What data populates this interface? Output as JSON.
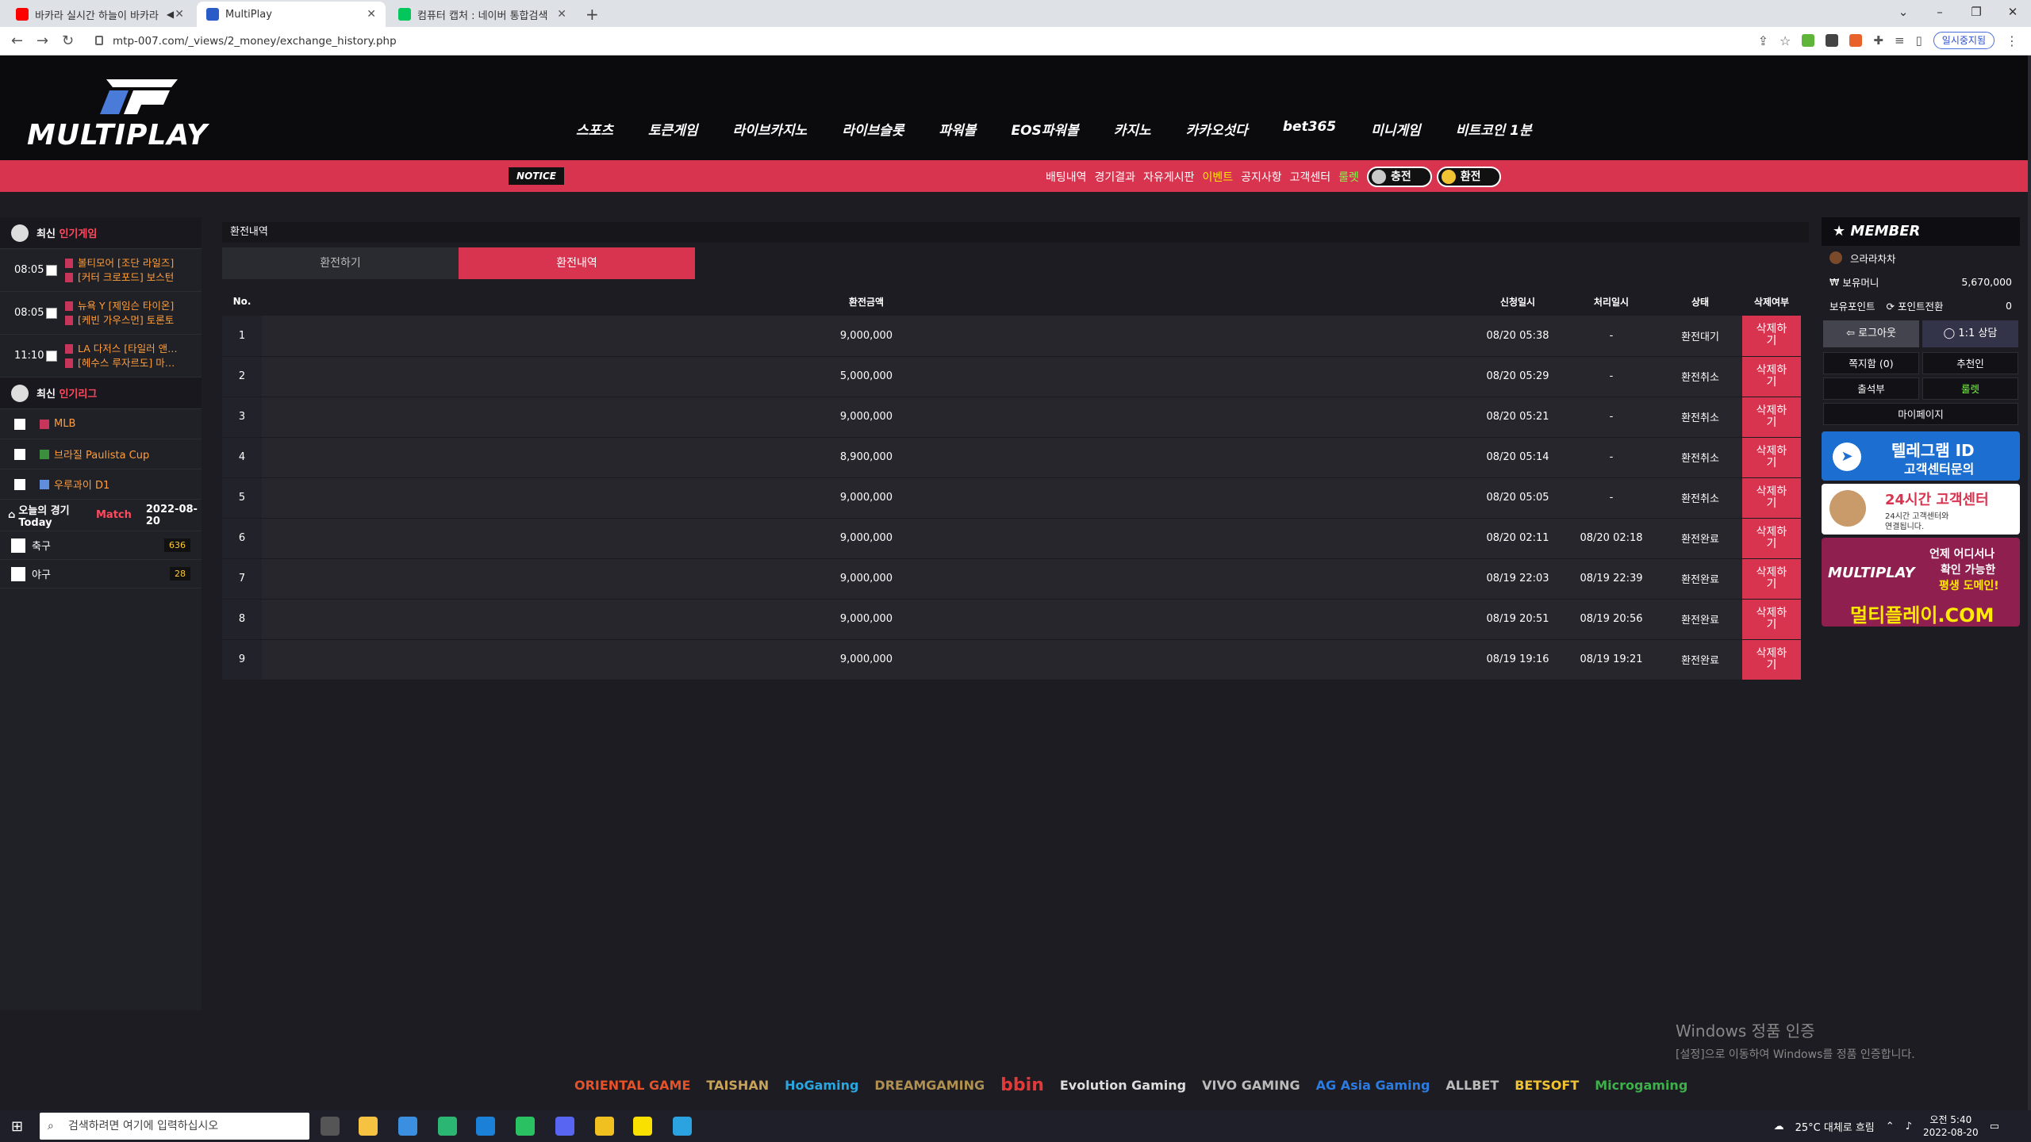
{
  "browser": {
    "tabs": [
      {
        "title": "바카라 실시간 하늘이 바카라",
        "icon": "youtube-icon",
        "color": "#ff0000",
        "active": false
      },
      {
        "title": "MultiPlay",
        "icon": "multiplay-icon",
        "color": "#2a5cc8",
        "active": true
      },
      {
        "title": "컴퓨터 캡처 : 네이버 통합검색",
        "icon": "naver-icon",
        "color": "#03c75a",
        "active": false
      }
    ],
    "url": "mtp-007.com/_views/2_money/exchange_history.php",
    "profile_label": "일시중지됨"
  },
  "site": {
    "logo_text": "MULTIPLAY",
    "nav": [
      "스포츠",
      "토큰게임",
      "라이브카지노",
      "라이브슬롯",
      "파워볼",
      "EOS파워볼",
      "카지노",
      "카카오섯다",
      "bet365",
      "미니게임",
      "비트코인 1분"
    ],
    "notice_badge": "NOTICE",
    "sublinks": [
      {
        "label": "배팅내역",
        "style": "normal"
      },
      {
        "label": "경기결과",
        "style": "normal"
      },
      {
        "label": "자유게시판",
        "style": "normal"
      },
      {
        "label": "이벤트",
        "style": "yellow"
      },
      {
        "label": "공지사항",
        "style": "normal"
      },
      {
        "label": "고객센터",
        "style": "normal"
      },
      {
        "label": "룰렛",
        "style": "green"
      }
    ],
    "charge_label": "충전",
    "exchange_label": "환전"
  },
  "left": {
    "recent_games_head": {
      "prefix": "최신",
      "highlight": "인기게임"
    },
    "games": [
      {
        "time": "08:05",
        "home": "볼티모어 [조단 라일즈]",
        "away": "[커터 크로포드] 보스턴"
      },
      {
        "time": "08:05",
        "home": "뉴욕 Y [제임슨 타이온]",
        "away": "[케빈 가우스먼] 토론토"
      },
      {
        "time": "11:10",
        "home": "LA 다저스 [타일러 앤…",
        "away": "[헤수스 루자르도] 마…"
      }
    ],
    "recent_league_head": {
      "prefix": "최신",
      "highlight": "인기리그"
    },
    "leagues": [
      "MLB",
      "브라질 Paulista Cup",
      "우루과이 D1"
    ],
    "today": {
      "prefix": "오늘의 경기 Today",
      "highlight": "Match",
      "date": "2022-08-20"
    },
    "sports": [
      {
        "name": "축구",
        "count": "636"
      },
      {
        "name": "야구",
        "count": "28"
      }
    ]
  },
  "main": {
    "page_title": "환전내역",
    "tab_exchange": "환전하기",
    "tab_history": "환전내역",
    "columns": {
      "no": "No.",
      "amount": "환전금액",
      "requested": "신청일시",
      "processed": "처리일시",
      "status": "상태",
      "delete": "삭제여부"
    },
    "rows": [
      {
        "no": "1",
        "amount": "9,000,000",
        "requested": "08/20 05:38",
        "processed": "-",
        "status": "환전대기",
        "delete": "삭제하기"
      },
      {
        "no": "2",
        "amount": "5,000,000",
        "requested": "08/20 05:29",
        "processed": "-",
        "status": "환전취소",
        "delete": "삭제하기"
      },
      {
        "no": "3",
        "amount": "9,000,000",
        "requested": "08/20 05:21",
        "processed": "-",
        "status": "환전취소",
        "delete": "삭제하기"
      },
      {
        "no": "4",
        "amount": "8,900,000",
        "requested": "08/20 05:14",
        "processed": "-",
        "status": "환전취소",
        "delete": "삭제하기"
      },
      {
        "no": "5",
        "amount": "9,000,000",
        "requested": "08/20 05:05",
        "processed": "-",
        "status": "환전취소",
        "delete": "삭제하기"
      },
      {
        "no": "6",
        "amount": "9,000,000",
        "requested": "08/20 02:11",
        "processed": "08/20 02:18",
        "status": "환전완료",
        "delete": "삭제하기"
      },
      {
        "no": "7",
        "amount": "9,000,000",
        "requested": "08/19 22:03",
        "processed": "08/19 22:39",
        "status": "환전완료",
        "delete": "삭제하기"
      },
      {
        "no": "8",
        "amount": "9,000,000",
        "requested": "08/19 20:51",
        "processed": "08/19 20:56",
        "status": "환전완료",
        "delete": "삭제하기"
      },
      {
        "no": "9",
        "amount": "9,000,000",
        "requested": "08/19 19:16",
        "processed": "08/19 19:21",
        "status": "환전완료",
        "delete": "삭제하기"
      }
    ]
  },
  "member": {
    "title": "MEMBER",
    "username": "으라라차차",
    "money_label": "보유머니",
    "money_value": "5,670,000",
    "point_label": "보유포인트",
    "point_convert": "포인트전환",
    "point_value": "0",
    "logout": "로그아웃",
    "consult": "1:1 상담",
    "notes": "쪽지함 (0)",
    "recommender": "추천인",
    "attendance": "출석부",
    "roulette": "룰렛",
    "mypage": "마이페이지",
    "banner1_line1": "텔레그램 ID",
    "banner1_line2": "고객센터문의",
    "banner2_line1": "24시간 고객센터",
    "banner2_line2": "24시간 고객센터와",
    "banner2_line3": "연결됩니다.",
    "banner3_line1": "언제 어디서나",
    "banner3_line2": "확인 가능한",
    "banner3_line3": "평생 도메인!",
    "banner3_logo": "MULTIPLAY",
    "banner3_domain": "멀티플레이.COM"
  },
  "watermark": {
    "line1": "Windows 정품 인증",
    "line2": "[설정]으로 이동하여 Windows를 정품 인증합니다."
  },
  "providers": [
    "ORIENTAL GAME",
    "TAISHAN",
    "HoGaming",
    "DREAMGAMING",
    "bbin",
    "Evolution Gaming",
    "VIVO GAMING",
    "AG Asia Gaming",
    "ALLBET",
    "BETSOFT",
    "Microgaming"
  ],
  "taskbar": {
    "search_placeholder": "검색하려면 여기에 입력하십시오",
    "weather": "25°C 대체로 흐림",
    "time": "오전 5:40",
    "date": "2022-08-20"
  }
}
